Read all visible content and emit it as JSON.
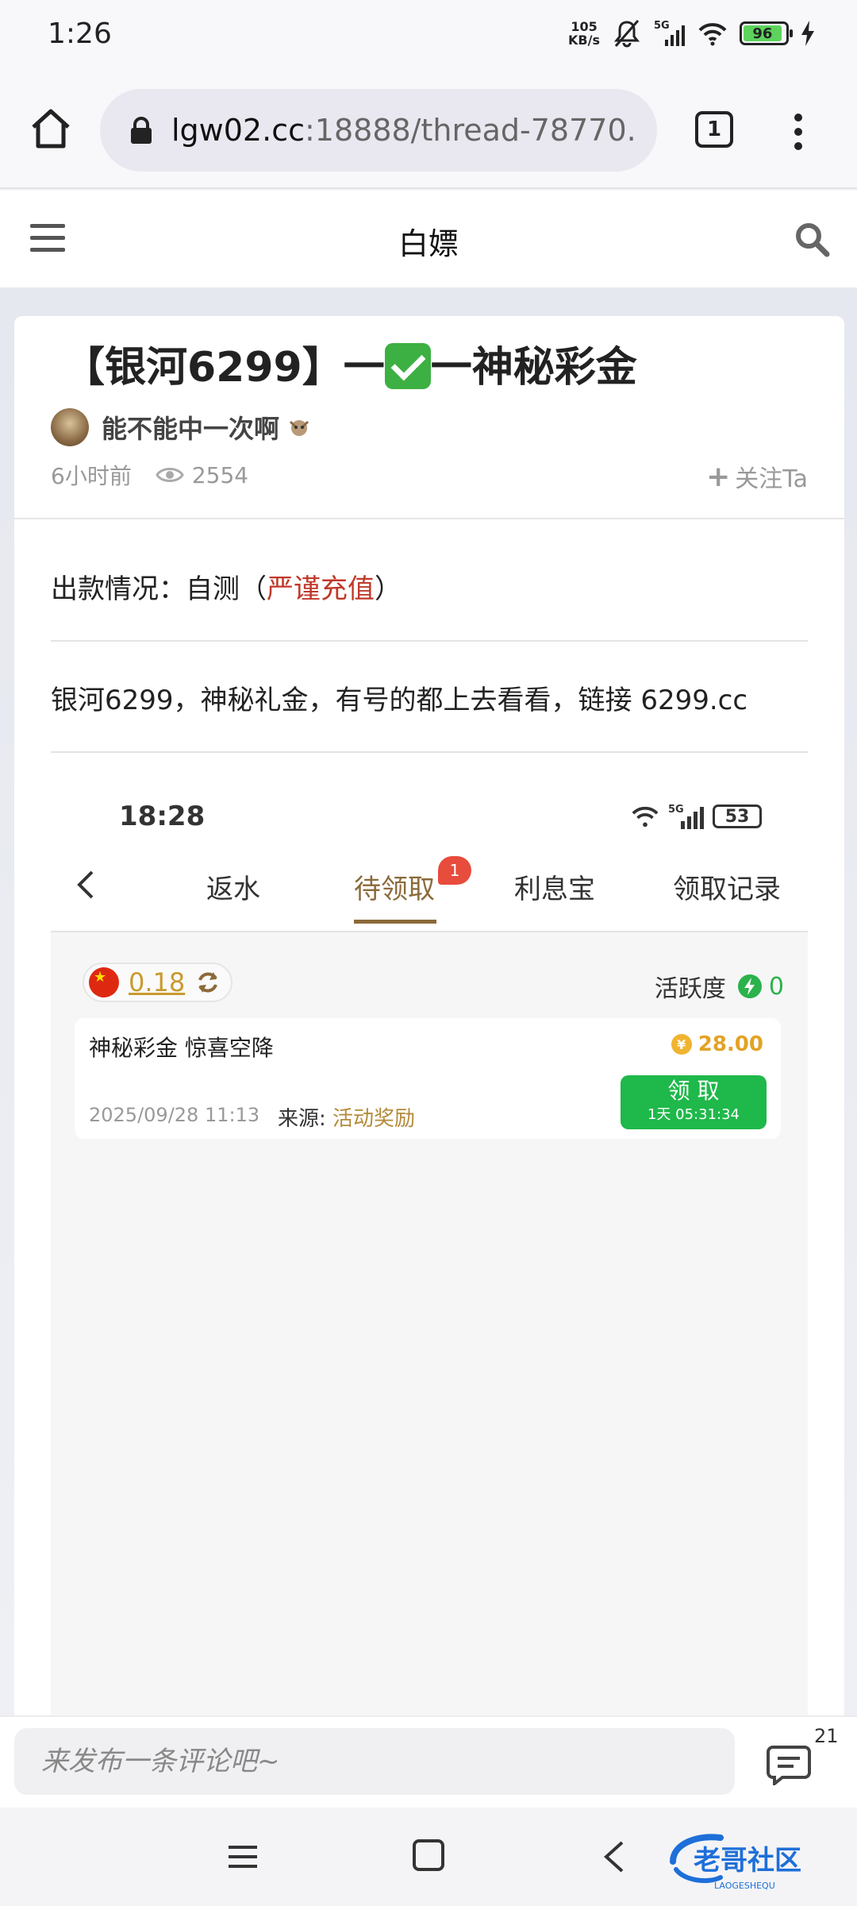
{
  "status_bar": {
    "time": "1:26",
    "speed_value": "105",
    "speed_unit": "KB/s",
    "network": "5G",
    "battery": "96"
  },
  "browser": {
    "url_host": "lgw02.cc",
    "url_path": ":18888/thread-78770.",
    "tab_count": "1"
  },
  "site_header": {
    "title": "白嫖"
  },
  "post": {
    "title_prefix": "【银河6299】一",
    "title_suffix": "一神秘彩金",
    "author": "能不能中一次啊",
    "time_ago": "6小时前",
    "views": "2554",
    "follow_label": "关注Ta",
    "withdraw_label": "出款情况：自测（",
    "withdraw_warning": "严谨充值",
    "withdraw_close": "）",
    "body_text": "银河6299，神秘礼金，有号的都上去看看，链接 6299.cc"
  },
  "screenshot": {
    "time": "18:28",
    "network": "5G",
    "battery": "53",
    "tabs": [
      {
        "label": "返水"
      },
      {
        "label": "待领取"
      },
      {
        "label": "利息宝"
      },
      {
        "label": "领取记录"
      }
    ],
    "active_tab_badge": "1",
    "balance": "0.18",
    "activity_label": "活跃度",
    "activity_value": "0",
    "bonus": {
      "name": "神秘彩金  惊喜空降",
      "amount": "28.00",
      "currency_symbol": "¥",
      "date": "2025/09/28 11:13",
      "source_label": "来源: ",
      "source_value": "活动奖励",
      "claim_label": "领 取",
      "countdown": "1天 05:31:34"
    }
  },
  "comment_bar": {
    "placeholder": "来发布一条评论吧~",
    "count": "21"
  },
  "watermark": {
    "text": "老哥社区",
    "subtext": "LAOGESHEQU"
  }
}
